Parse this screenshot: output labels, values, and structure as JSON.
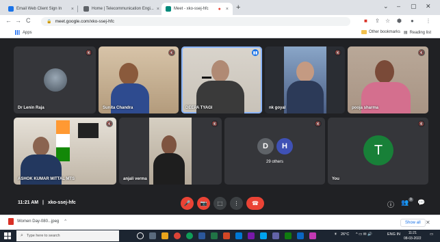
{
  "browser": {
    "tabs": [
      {
        "title": "Email Web Client Sign In",
        "color": "#1a73e8",
        "active": false
      },
      {
        "title": "Home | Telecommunication Engi...",
        "color": "#5f6368",
        "active": false
      },
      {
        "title": "Meet - xko-ssej-hfc",
        "color": "#00897b",
        "active": true
      }
    ],
    "new_tab": "+",
    "window_controls": [
      "⌄",
      "–",
      "▢",
      "✕"
    ],
    "url": "meet.google.com/xko-ssej-hfc",
    "nav": {
      "back": "←",
      "forward": "→",
      "reload": "C"
    },
    "bookmarks": {
      "apps": "Apps",
      "other": "Other bookmarks",
      "reading": "Reading list"
    }
  },
  "meet": {
    "participants": [
      {
        "name": "Dr Lenin Raja",
        "kind": "avatar-photo",
        "mic": "muted"
      },
      {
        "name": "Sunita Chandra",
        "kind": "video",
        "mic": "muted"
      },
      {
        "name": "DEEPA TYAGI",
        "kind": "video",
        "mic": "speaking"
      },
      {
        "name": "nk goyal",
        "kind": "video",
        "mic": "muted"
      },
      {
        "name": "pooja sharma",
        "kind": "video",
        "mic": "muted"
      },
      {
        "name": "ASHOK KUMAR MITTAL MTS",
        "kind": "video",
        "mic": "muted"
      },
      {
        "name": "anjali verma",
        "kind": "video",
        "mic": "muted"
      },
      {
        "name": "29 others",
        "kind": "group",
        "initials": [
          "D",
          "H"
        ],
        "mic": "muted"
      },
      {
        "name": "You",
        "kind": "avatar",
        "initial": "T",
        "mic": "muted"
      }
    ],
    "time": "11:21 AM",
    "separator": "|",
    "meeting_code": "xko-ssej-hfc",
    "controls": {
      "mic": "🎤",
      "cam": "📷",
      "present": "⬚",
      "more": "⋮",
      "leave": "☎"
    },
    "right_controls": {
      "info": "ⓘ",
      "people": "👥",
      "chat": "💬",
      "people_count": "9"
    }
  },
  "download": {
    "file": "Women Day-080...jpeg",
    "show_all": "Show all",
    "close": "✕"
  },
  "taskbar": {
    "search_placeholder": "Type here to search",
    "weather": "26°C",
    "lang": "ENG IN",
    "clock_time": "11:21",
    "clock_date": "08-03-2022"
  },
  "colors": {
    "meet_bg": "#202124",
    "tile_bg": "#3c4043",
    "red": "#ea4335",
    "you_avatar": "#188038"
  }
}
